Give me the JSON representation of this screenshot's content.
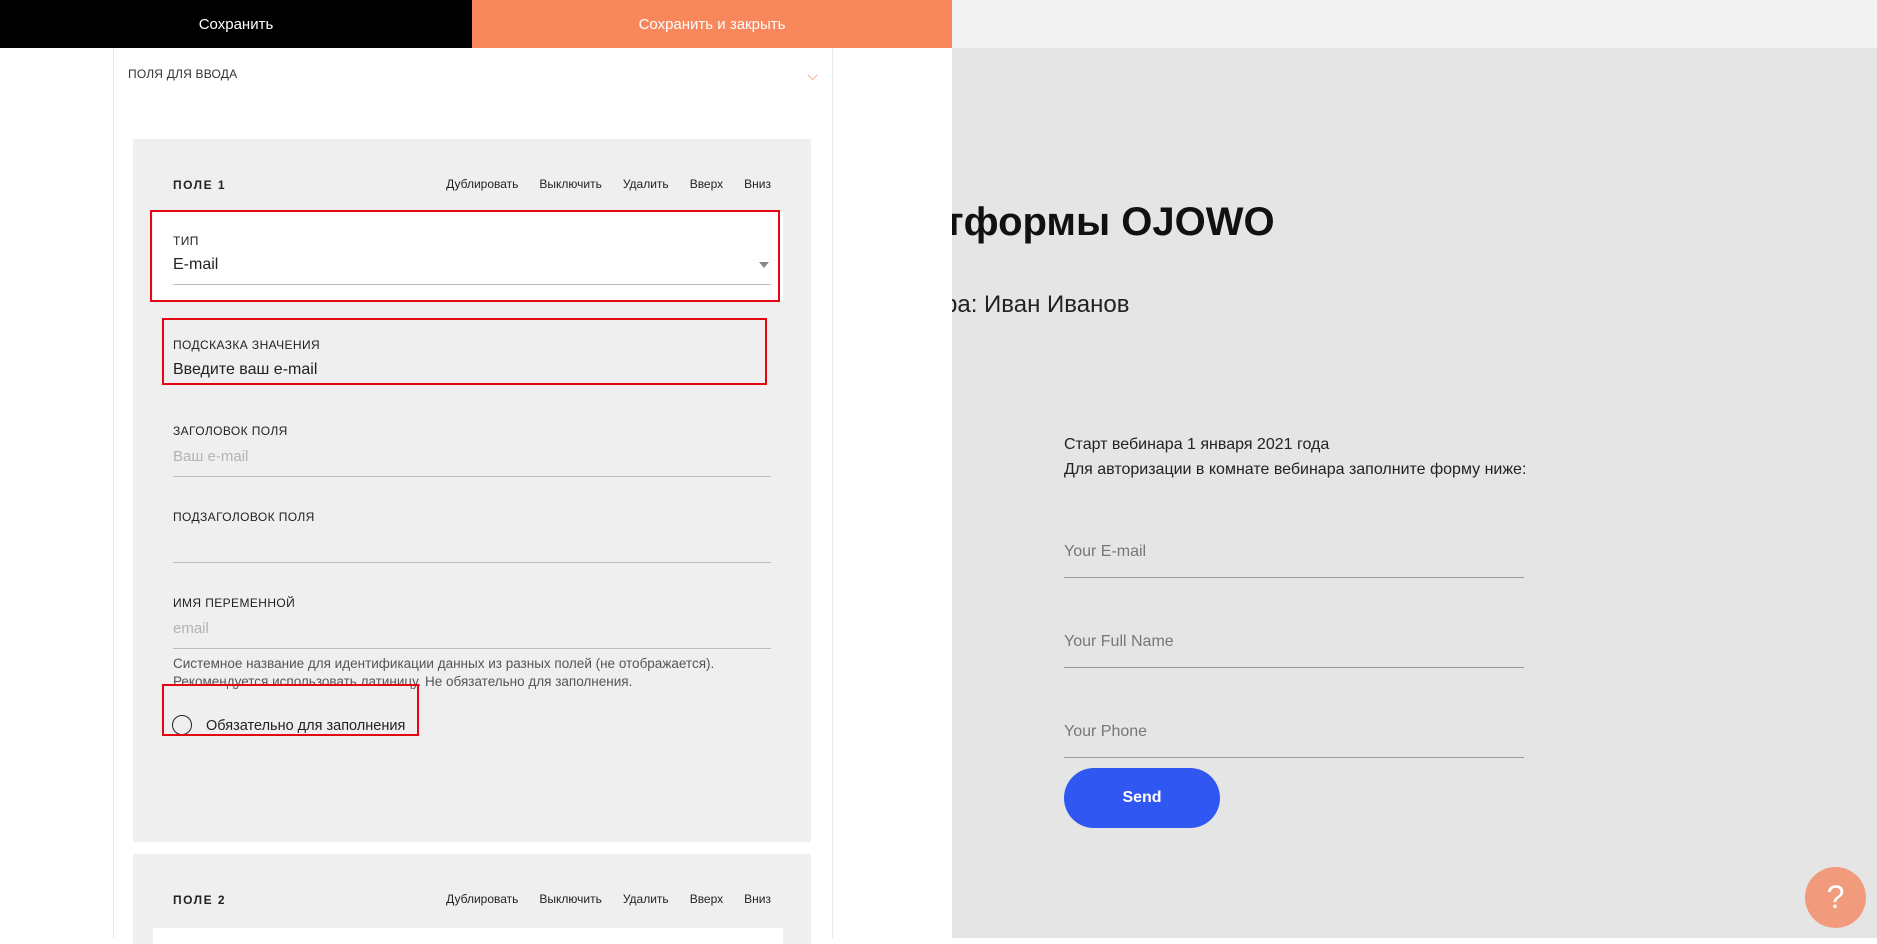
{
  "toolbar": {
    "save_label": "Сохранить",
    "save_close_label": "Сохранить и закрыть"
  },
  "section": {
    "title": "ПОЛЯ ДЛЯ ВВОДА",
    "chevron": "⌵"
  },
  "field1": {
    "title": "ПОЛЕ 1",
    "actions": {
      "duplicate": "Дублировать",
      "disable": "Выключить",
      "delete": "Удалить",
      "up": "Вверх",
      "down": "Вниз"
    },
    "type_label": "ТИП",
    "type_value": "E-mail",
    "hint_label": "ПОДСКАЗКА ЗНАЧЕНИЯ",
    "hint_value": "Введите ваш e-mail",
    "title_label": "ЗАГОЛОВОК ПОЛЯ",
    "title_placeholder": "Ваш e-mail",
    "subtitle_label": "ПОДЗАГОЛОВОК ПОЛЯ",
    "var_label": "ИМЯ ПЕРЕМЕННОЙ",
    "var_placeholder": "email",
    "var_hint_1": "Системное название для идентификации данных из разных полей (не отображается).",
    "var_hint_2": "Рекомендуется использовать латиницу. Не обязательно для заполнения.",
    "required_label": "Обязательно для заполнения"
  },
  "field2": {
    "title": "ПОЛЕ 2",
    "actions": {
      "duplicate": "Дублировать",
      "disable": "Выключить",
      "delete": "Удалить",
      "up": "Вверх",
      "down": "Вниз"
    }
  },
  "preview": {
    "title": "тформы OJOWO",
    "subtitle": "ра: Иван Иванов",
    "text_1": "Старт вебинара 1 января 2021 года",
    "text_2": "Для авторизации в комнате вебинара заполните форму ниже:",
    "email_placeholder": "Your E-mail",
    "name_placeholder": "Your Full Name",
    "phone_placeholder": "Your Phone",
    "send_label": "Send"
  },
  "help": {
    "label": "?",
    "icon": "question-icon"
  },
  "colors": {
    "accent": "#f8875b",
    "highlight": "#e30613",
    "send_button": "#3157f2",
    "help_button": "#f19a7c"
  }
}
